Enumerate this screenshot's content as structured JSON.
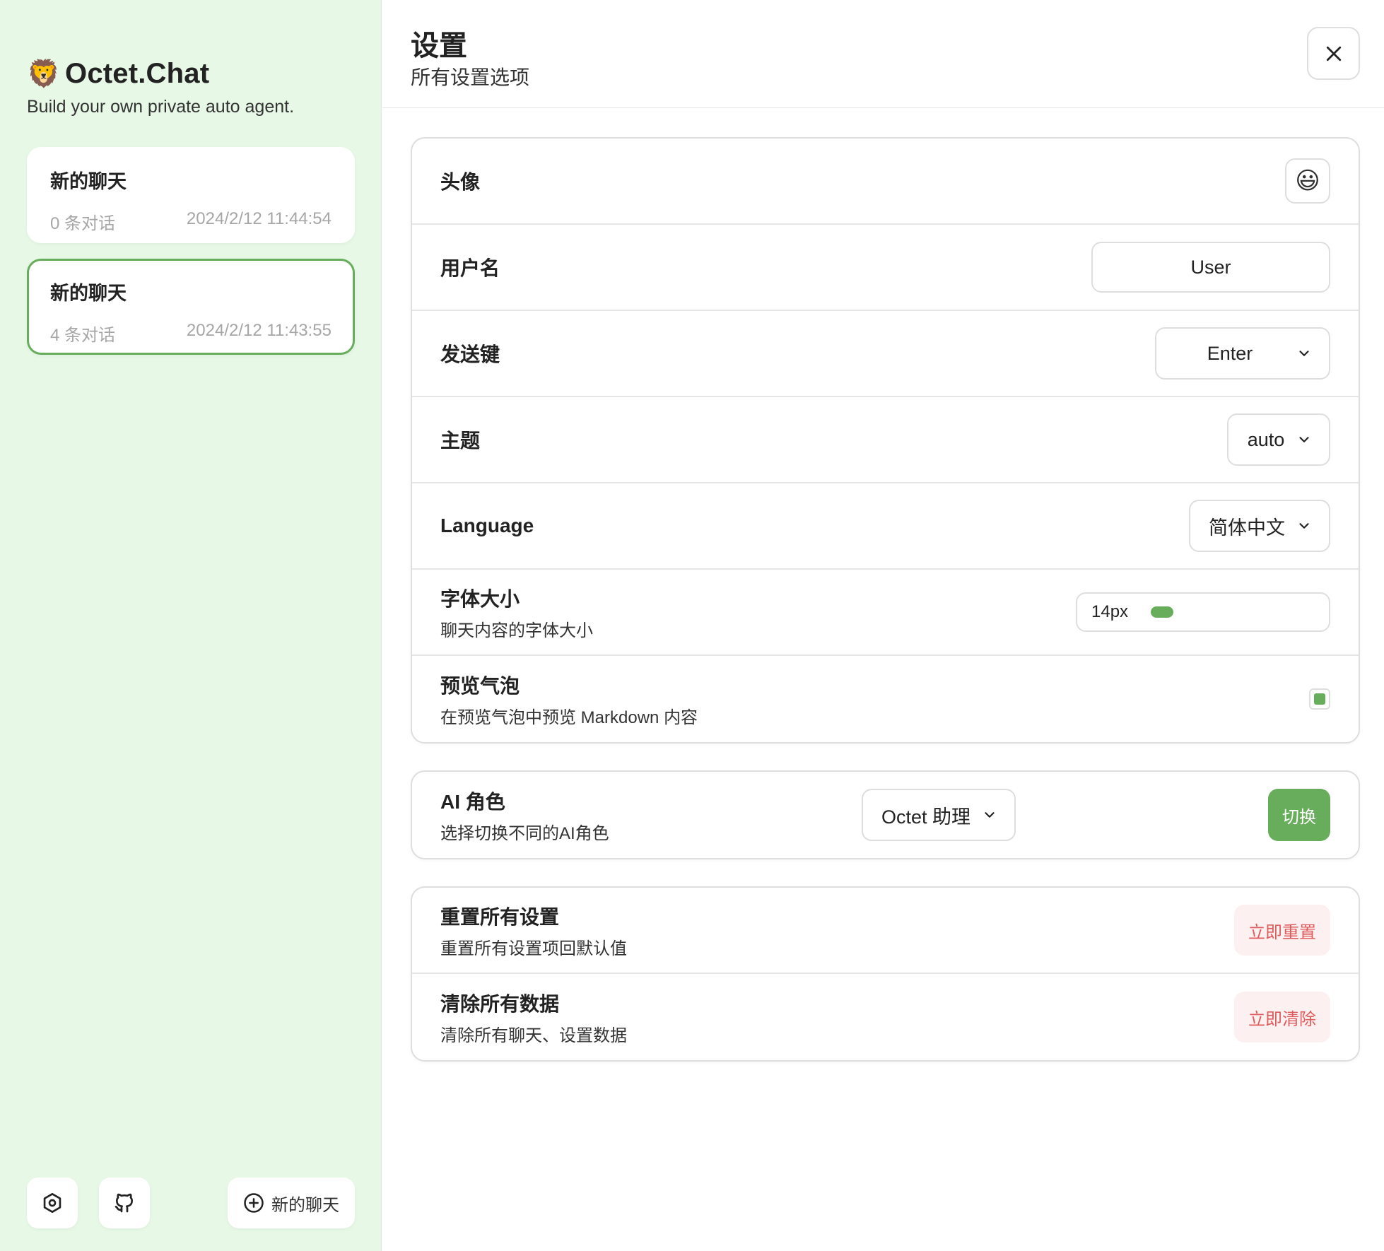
{
  "sidebar": {
    "brand_emoji": "🦁",
    "title": "Octet.Chat",
    "subtitle": "Build your own private auto agent.",
    "chats": [
      {
        "title": "新的聊天",
        "count": "0 条对话",
        "time": "2024/2/12 11:44:54",
        "active": false
      },
      {
        "title": "新的聊天",
        "count": "4 条对话",
        "time": "2024/2/12 11:43:55",
        "active": true
      }
    ],
    "new_chat_label": "新的聊天"
  },
  "header": {
    "title": "设置",
    "subtitle": "所有设置选项"
  },
  "settings": {
    "avatar": {
      "label": "头像",
      "emoji": "😃"
    },
    "username": {
      "label": "用户名",
      "value": "User"
    },
    "send_key": {
      "label": "发送键",
      "value": "Enter"
    },
    "theme": {
      "label": "主题",
      "value": "auto"
    },
    "language": {
      "label": "Language",
      "value": "简体中文"
    },
    "font_size": {
      "label": "字体大小",
      "sub": "聊天内容的字体大小",
      "value": "14px",
      "fill_fraction": 0.14
    },
    "preview_bubble": {
      "label": "预览气泡",
      "sub": "在预览气泡中预览 Markdown 内容",
      "checked": true
    }
  },
  "ai_role": {
    "label": "AI 角色",
    "sub": "选择切换不同的AI角色",
    "value": "Octet 助理",
    "button": "切换"
  },
  "danger": {
    "reset": {
      "label": "重置所有设置",
      "sub": "重置所有设置项回默认值",
      "button": "立即重置"
    },
    "clear": {
      "label": "清除所有数据",
      "sub": "清除所有聊天、设置数据",
      "button": "立即清除"
    }
  },
  "colors": {
    "accent": "#67ad5b",
    "sidebar_bg": "#e7f8e6",
    "danger_text": "#e05c5c",
    "danger_bg": "#fdf0f0"
  }
}
